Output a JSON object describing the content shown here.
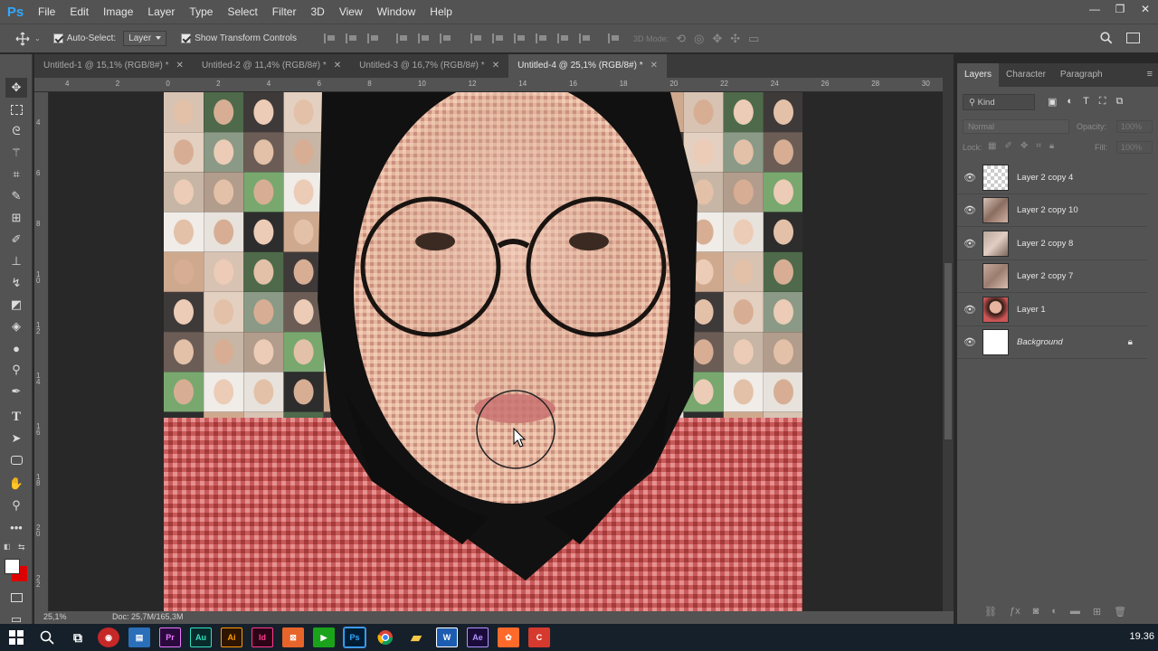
{
  "app": {
    "logo": "Ps"
  },
  "menu": [
    "File",
    "Edit",
    "Image",
    "Layer",
    "Type",
    "Select",
    "Filter",
    "3D",
    "View",
    "Window",
    "Help"
  ],
  "window_controls": {
    "minimize": "—",
    "restore": "❐",
    "close": "✕"
  },
  "options": {
    "auto_select_label": "Auto-Select:",
    "auto_select_value": "Layer",
    "show_transform_label": "Show Transform Controls",
    "three_d_label": "3D Mode:"
  },
  "tabs": [
    {
      "label": "Untitled-1 @ 15,1% (RGB/8#) *"
    },
    {
      "label": "Untitled-2 @ 11,4% (RGB/8#) *"
    },
    {
      "label": "Untitled-3 @ 16,7% (RGB/8#) *"
    },
    {
      "label": "Untitled-4 @ 25,1% (RGB/8#) *"
    }
  ],
  "ruler_h": [
    "4",
    "2",
    "0",
    "2",
    "4",
    "6",
    "8",
    "10",
    "12",
    "14",
    "16",
    "18",
    "20",
    "22",
    "24",
    "26",
    "28",
    "30"
  ],
  "ruler_v": [
    "4",
    "6",
    "8",
    "1 0",
    "1 2",
    "1 4",
    "1 6",
    "1 8",
    "2 0",
    "2 2"
  ],
  "status": {
    "zoom": "25,1%",
    "doc": "Doc: 25,7M/165,3M"
  },
  "panel": {
    "tabs": [
      "Layers",
      "Character",
      "Paragraph"
    ],
    "filter_kind": "Kind",
    "blend_mode": "Normal",
    "opacity_label": "Opacity:",
    "opacity_value": "100%",
    "lock_label": "Lock:",
    "fill_label": "Fill:",
    "fill_value": "100%",
    "layers": [
      {
        "name": "Layer 2 copy 4",
        "visible": true
      },
      {
        "name": "Layer 2 copy 10",
        "visible": true
      },
      {
        "name": "Layer 2 copy 8",
        "visible": true
      },
      {
        "name": "Layer 2 copy 7",
        "visible": false
      },
      {
        "name": "Layer 1",
        "visible": true
      },
      {
        "name": "Background",
        "visible": true
      }
    ]
  },
  "taskbar": {
    "apps": [
      {
        "label": "Pr",
        "color": "#2a0a3c",
        "fg": "#ea77ff"
      },
      {
        "label": "Au",
        "color": "#0a2b2b",
        "fg": "#2fe3c1"
      },
      {
        "label": "Ai",
        "color": "#2f1400",
        "fg": "#ff9a00"
      },
      {
        "label": "Id",
        "color": "#2c0418",
        "fg": "#ff3b8d"
      },
      {
        "label": "Ps",
        "color": "#001d34",
        "fg": "#31a8ff"
      },
      {
        "label": "W",
        "color": "#1c5db1",
        "fg": "#ffffff"
      },
      {
        "label": "Ae",
        "color": "#1a0b3b",
        "fg": "#b293ff"
      }
    ],
    "clock": "19.36"
  }
}
